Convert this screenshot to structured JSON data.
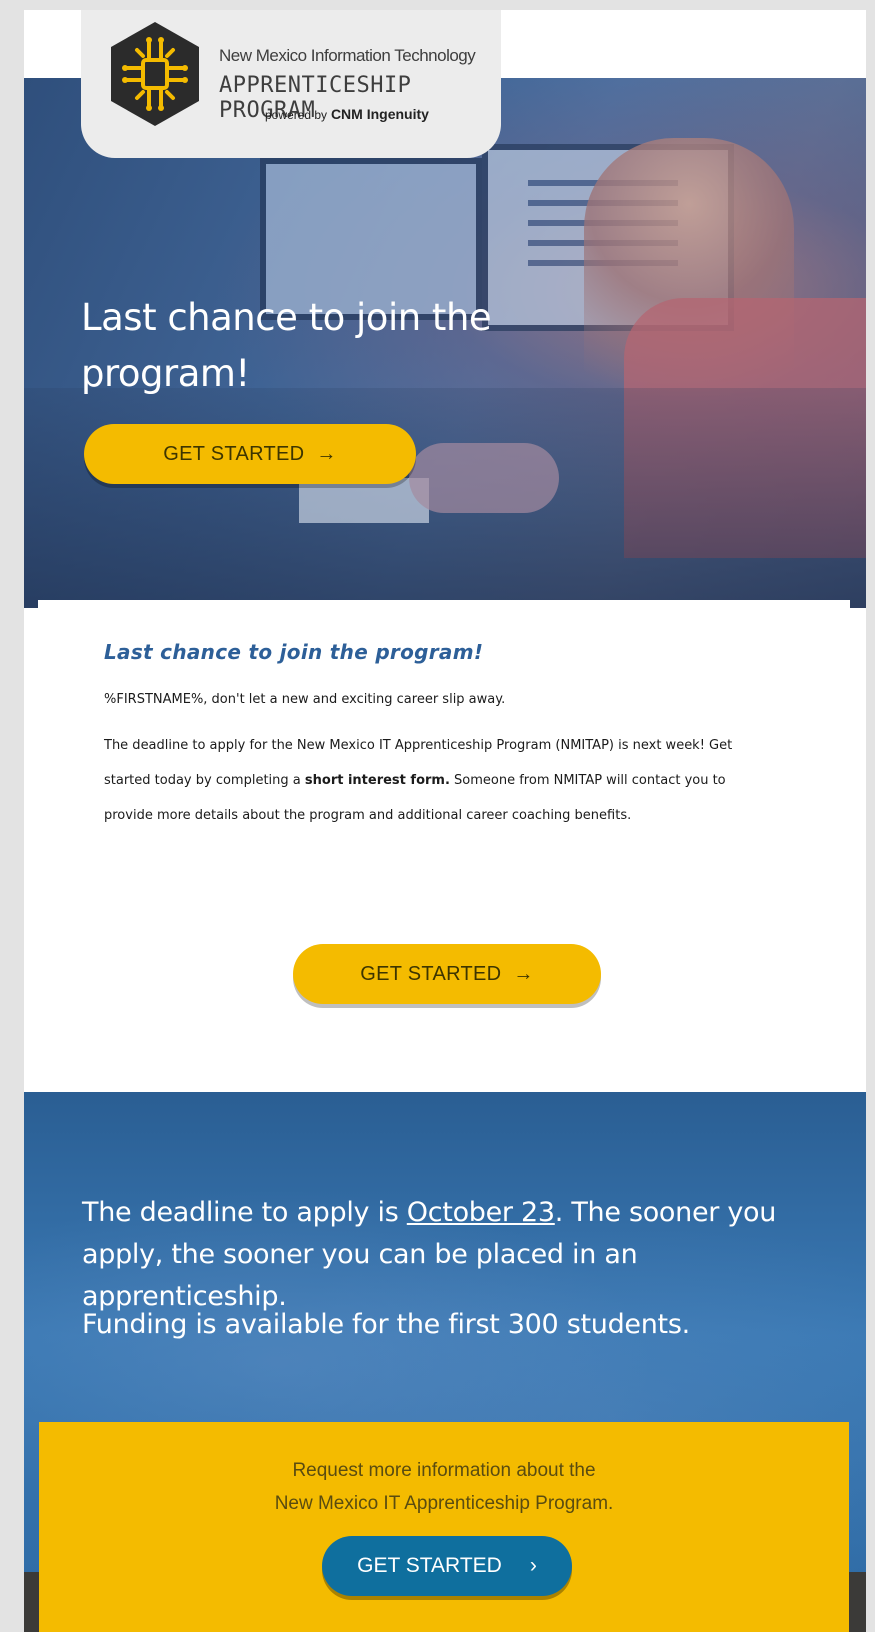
{
  "logo": {
    "line1": "New Mexico Information Technology",
    "line2": "APPRENTICESHIP PROGRAM",
    "powered_by": "powered by",
    "brand": "CNM Ingenuity"
  },
  "hero": {
    "title": "Last chance to join the program!",
    "button_label": "GET STARTED",
    "button_arrow": "→"
  },
  "content": {
    "heading": "Last chance to join the program!",
    "greeting": "%FIRSTNAME%, don't let a new and exciting career slip away.",
    "body_part1": "The deadline to apply for the New Mexico IT Apprenticeship Program (NMITAP) is next week! Get started today by completing a ",
    "body_bold": "short interest form.",
    "body_part2": " Someone from NMITAP will contact you to provide more details about the program and additional career coaching benefits.",
    "button_label": "GET STARTED",
    "button_arrow": "→"
  },
  "band": {
    "deadline_prefix": "The deadline to apply is ",
    "deadline_date": "October 23",
    "deadline_suffix": ". The sooner you apply, the sooner you can be placed in an apprenticeship.",
    "funding": "Funding is available for the first 300 students."
  },
  "cta": {
    "info_line1": "Request more information about the",
    "info_line2": "New Mexico IT Apprenticeship Program.",
    "button_label": "GET STARTED",
    "button_arrow": "›"
  },
  "colors": {
    "accent_yellow": "#f4bb00",
    "heading_blue": "#2d5f98",
    "button_blue": "#0f6f9e"
  }
}
